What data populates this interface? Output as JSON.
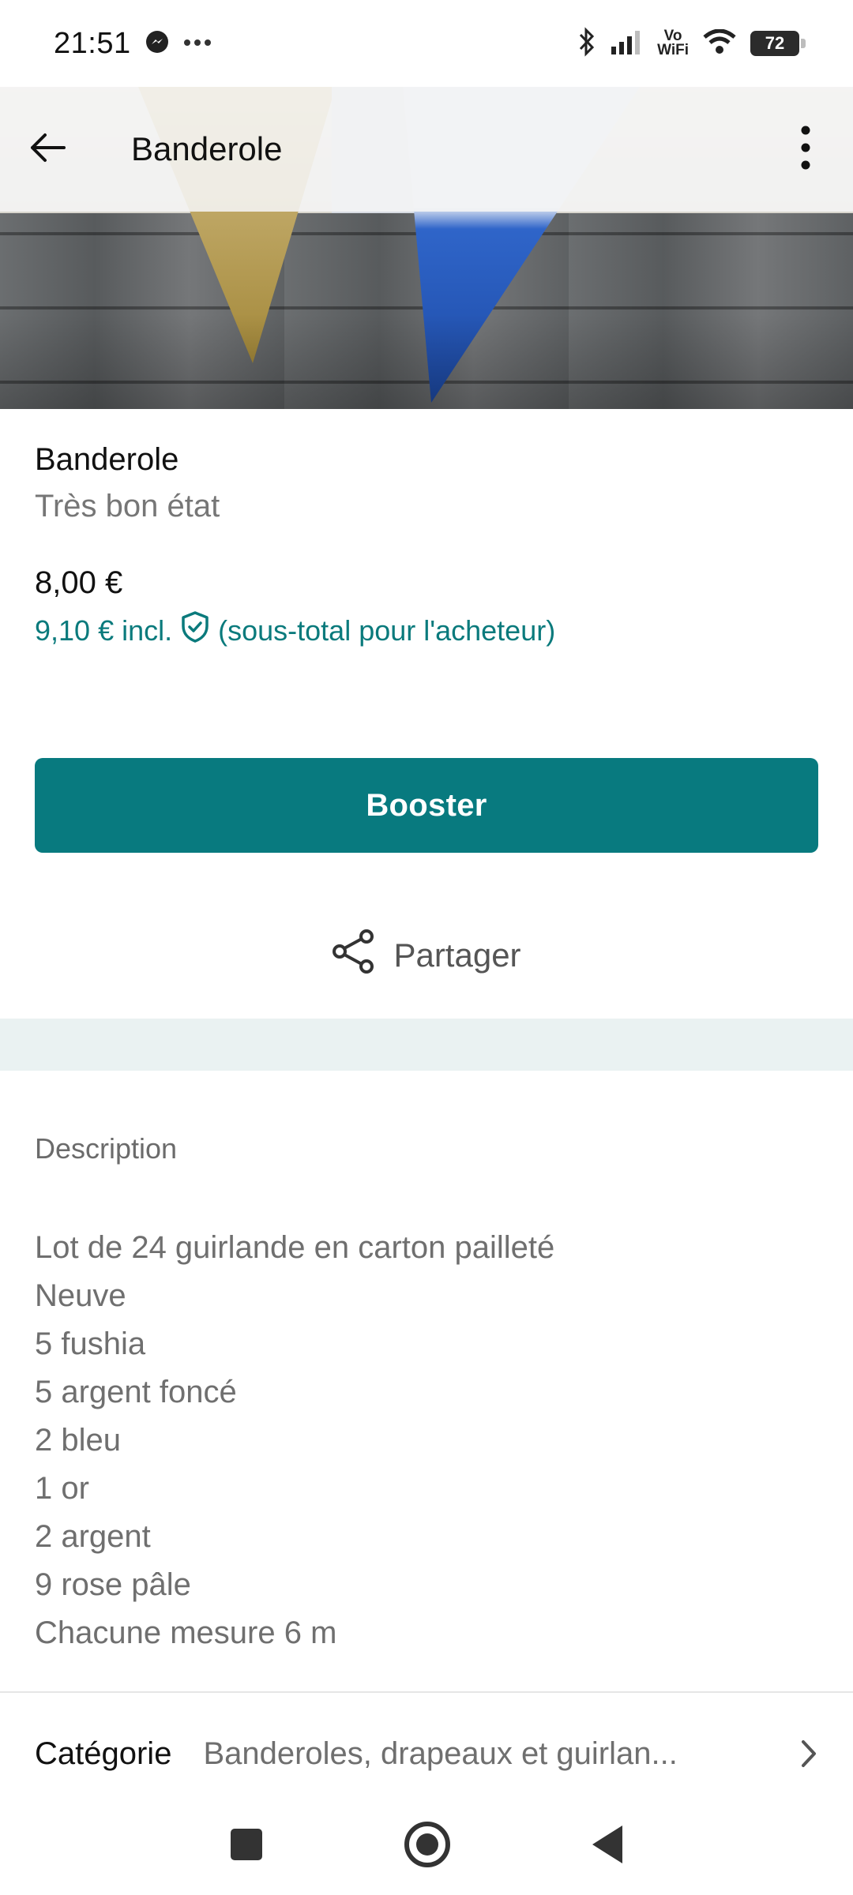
{
  "status_bar": {
    "time": "21:51",
    "vowifi_top": "Vo",
    "vowifi_bottom": "WiFi",
    "battery": "72",
    "icons": [
      "messenger-icon",
      "more-dots-icon",
      "bluetooth-icon",
      "signal-icon",
      "wifi-icon",
      "battery-icon"
    ]
  },
  "topbar": {
    "title": "Banderole",
    "back_icon": "arrow-left-icon",
    "menu_icon": "more-vertical-icon"
  },
  "item": {
    "title": "Banderole",
    "condition": "Très bon état",
    "price": "8,00 €",
    "buyer_price": "9,10 €",
    "buyer_incl": "incl.",
    "buyer_note": "(sous-total pour l'acheteur)",
    "protection_icon": "shield-check-icon"
  },
  "actions": {
    "booster_label": "Booster",
    "share_label": "Partager",
    "share_icon": "share-icon"
  },
  "description": {
    "label": "Description",
    "lines": [
      "Lot de 24 guirlande en carton pailleté",
      "Neuve",
      "5 fushia",
      "5 argent foncé",
      "2 bleu",
      "1 or",
      "2 argent",
      "9 rose pâle",
      "Chacune mesure 6 m"
    ]
  },
  "category": {
    "label": "Catégorie",
    "value": "Banderoles, drapeaux et guirlan..."
  },
  "colors": {
    "accent": "#087a7f",
    "accent_text": "#0a7a7c",
    "band": "#eaf2f2"
  }
}
